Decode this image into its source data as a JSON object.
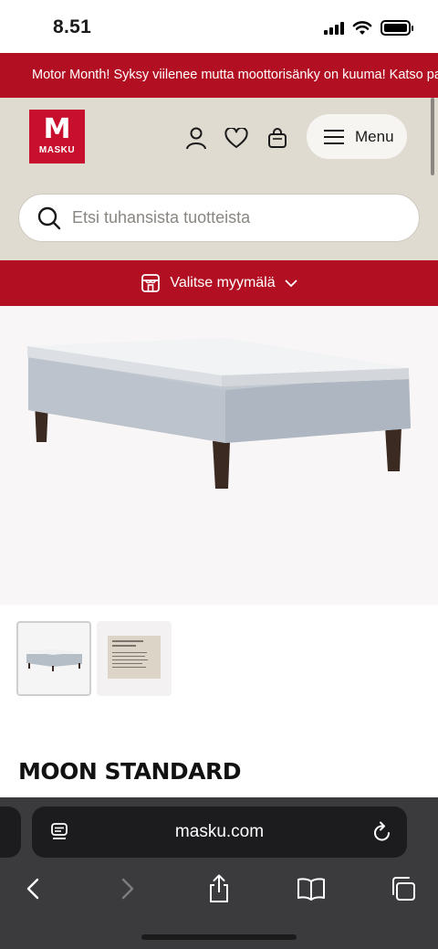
{
  "status_bar": {
    "time": "8.51"
  },
  "promo": {
    "text": "Motor Month! Syksy viilenee mutta moottorisänky on kuuma! Katso parhaat tarjoukset"
  },
  "header": {
    "logo_letter": "M",
    "logo_word": "MASKU",
    "menu_label": "Menu",
    "icons": [
      "account-icon",
      "heart-icon",
      "cart-bag-icon",
      "hamburger-icon"
    ]
  },
  "search": {
    "placeholder": "Etsi tuhansista tuotteista"
  },
  "store_selector": {
    "label": "Valitse myymälä"
  },
  "product": {
    "title": "MOON STANDARD",
    "thumbnails": [
      "bed-photo",
      "info-card"
    ]
  },
  "browser": {
    "url": "masku.com"
  },
  "colors": {
    "brand_red": "#b30f23",
    "header_beige": "#e0dbd1",
    "toolbar_dark": "#3b3b3d"
  }
}
